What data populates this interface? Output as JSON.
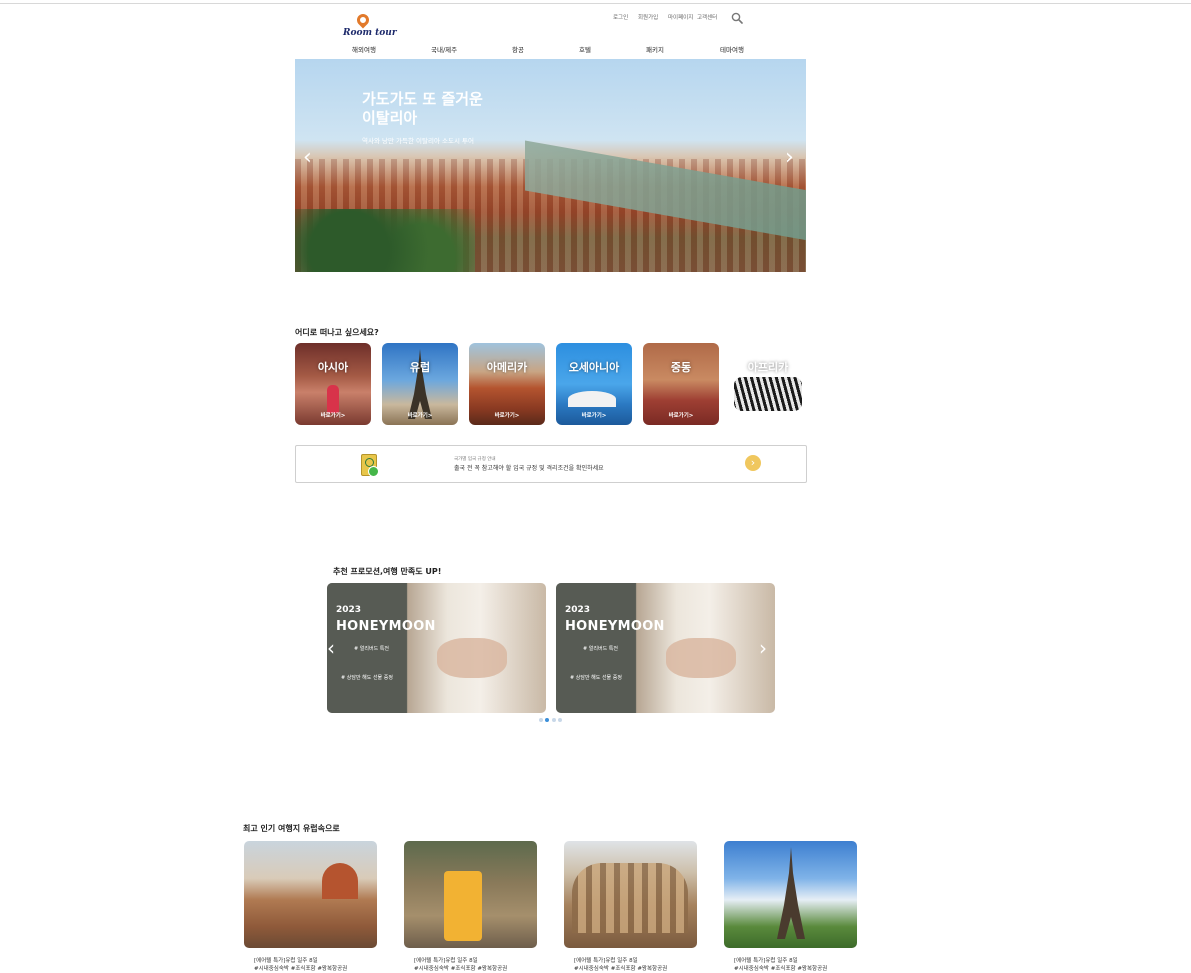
{
  "header": {
    "logo_text": "Room tour",
    "util_links": [
      "로그인",
      "회원가입",
      "마이페이지",
      "고객센터"
    ],
    "nav": [
      "해외여행",
      "국내/제주",
      "항공",
      "호텔",
      "패키지",
      "테마여행"
    ]
  },
  "hero": {
    "title_line1": "가도가도 또 즐거운",
    "title_line2": "이탈리아",
    "subtitle": "역사와 낭만 가득한 이탈리아 소도시 투어",
    "prev": "‹",
    "next": "›"
  },
  "regions": {
    "heading": "어디로 떠나고 싶으세요?",
    "items": [
      {
        "name": "아시아",
        "go": "바로가기>"
      },
      {
        "name": "유럽",
        "go": "바로가기>"
      },
      {
        "name": "아메리카",
        "go": "바로가기>"
      },
      {
        "name": "오세아니아",
        "go": "바로가기>"
      },
      {
        "name": "중동",
        "go": "바로가기>"
      },
      {
        "name": "아프리카",
        "go": "바로가기>"
      }
    ]
  },
  "notice": {
    "small": "국가별 입국 규정 안내",
    "main": "출국 전 꼭 참고해야 할 입국 규정 및 격리조건을 확인하세요",
    "button": "›"
  },
  "promo": {
    "heading": "추천 프로모션,여행 만족도 UP!",
    "cards": [
      {
        "year": "2023",
        "title": "HONEYMOON",
        "tag1": "# 얼리버드 특전",
        "tag2": "# 상담만 해도 선물 증정"
      },
      {
        "year": "2023",
        "title": "HONEYMOON",
        "tag1": "# 얼리버드 특전",
        "tag2": "# 상담만 해도 선물 증정"
      }
    ],
    "prev": "‹",
    "next": "›"
  },
  "popular": {
    "heading": "최고 인기 여행지 유럽속으로",
    "items": [
      {
        "line1": "[에어텔 특가]유럽 일주 8일",
        "line2": "#시내중심숙박 #조식포함 #왕복항공권"
      },
      {
        "line1": "[에어텔 특가]유럽 일주 8일",
        "line2": "#시내중심숙박 #조식포함 #왕복항공권"
      },
      {
        "line1": "[에어텔 특가]유럽 일주 8일",
        "line2": "#시내중심숙박 #조식포함 #왕복항공권"
      },
      {
        "line1": "[에어텔 특가]유럽 일주 8일",
        "line2": "#시내중심숙박 #조식포함 #왕복항공권"
      }
    ]
  }
}
